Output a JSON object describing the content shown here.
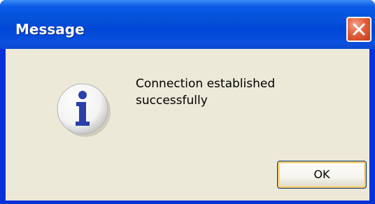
{
  "window": {
    "title": "Message",
    "close_icon": "close-icon"
  },
  "dialog": {
    "icon": "info-icon",
    "message_line_1": "Connection established",
    "message_line_2": "successfully",
    "ok_label": "OK"
  },
  "colors": {
    "titlebar": "#0552d8",
    "frame": "#0831d9",
    "body_background": "#ece9d8",
    "close_button": "#e2603b",
    "info_letter": "#2b3fa8",
    "button_focus": "#f5c56a"
  }
}
